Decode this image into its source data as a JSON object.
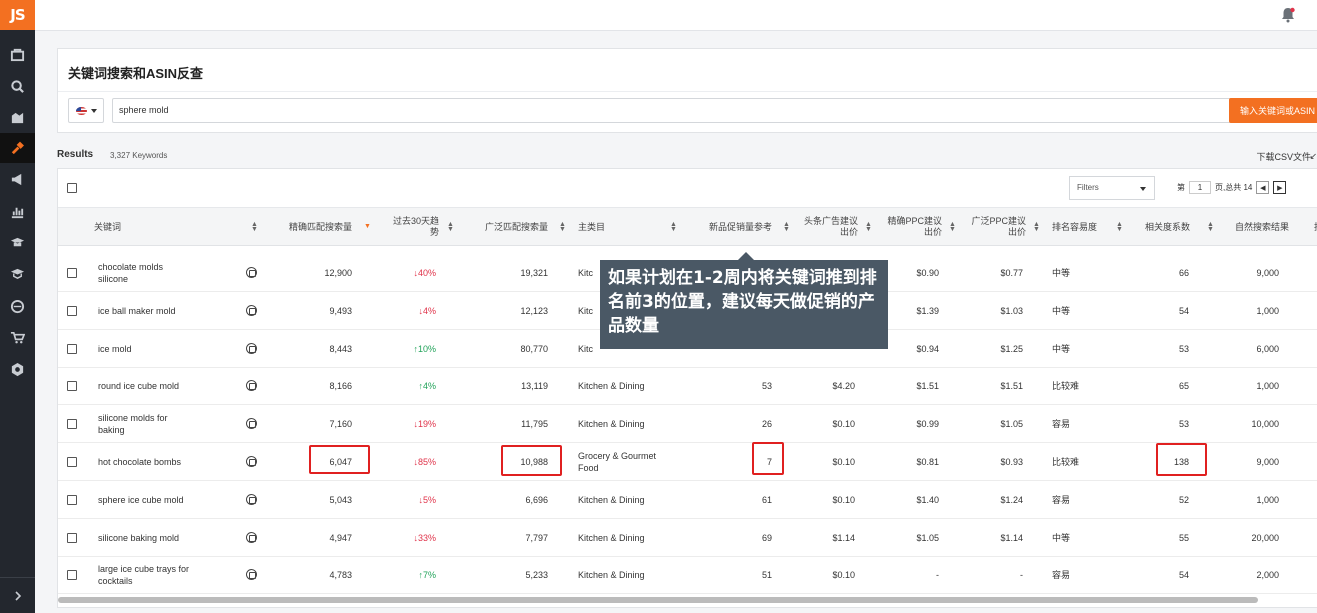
{
  "sidebar": {
    "logo": "JS",
    "icons": [
      "product-icon",
      "search-icon",
      "market-icon",
      "keyword-icon",
      "megaphone-icon",
      "chart-icon",
      "graduation-icon",
      "course-icon",
      "globe-icon",
      "cart-icon",
      "settings-icon"
    ],
    "expand_icon": "chevron-right-icon",
    "accent": "#f37021"
  },
  "topbar": {
    "notification_icon": "bell-icon"
  },
  "search": {
    "title": "关键词搜索和ASIN反查",
    "country": "US",
    "query": "sphere mold",
    "button": "输入关键词或ASIN"
  },
  "results": {
    "label": "Results",
    "count": "3,327 Keywords",
    "csv": "下载CSV文件"
  },
  "toolbar": {
    "filters": "Filters",
    "page_prefix": "第",
    "page": "1",
    "page_suffix": "页,总共 14"
  },
  "columns": [
    "关键词",
    "精确匹配搜索量",
    "过去30天趋势",
    "广泛匹配搜索量",
    "主类目",
    "新品促销量参考",
    "头条广告建议出价",
    "精确PPC建议出价",
    "广泛PPC建议出价",
    "排名容易度",
    "相关度系数",
    "自然搜索结果",
    "投"
  ],
  "rows": [
    {
      "keyword": "chocolate molds silicone",
      "exact": "12,900",
      "trend": "↓40%",
      "trend_dir": "down",
      "broad": "19,321",
      "category": "Kitc",
      "promo": "",
      "headline": "",
      "exact_ppc": "$0.90",
      "broad_ppc": "$0.77",
      "ease": "中等",
      "relevance": "66",
      "organic": "9,000"
    },
    {
      "keyword": "ice ball maker mold",
      "exact": "9,493",
      "trend": "↓4%",
      "trend_dir": "down",
      "broad": "12,123",
      "category": "Kitc",
      "promo": "",
      "headline": "",
      "exact_ppc": "$1.39",
      "broad_ppc": "$1.03",
      "ease": "中等",
      "relevance": "54",
      "organic": "1,000"
    },
    {
      "keyword": "ice mold",
      "exact": "8,443",
      "trend": "↑10%",
      "trend_dir": "up",
      "broad": "80,770",
      "category": "Kitc",
      "promo": "",
      "headline": "",
      "exact_ppc": "$0.94",
      "broad_ppc": "$1.25",
      "ease": "中等",
      "relevance": "53",
      "organic": "6,000"
    },
    {
      "keyword": "round ice cube mold",
      "exact": "8,166",
      "trend": "↑4%",
      "trend_dir": "up",
      "broad": "13,119",
      "category": "Kitchen & Dining",
      "promo": "53",
      "headline": "$4.20",
      "exact_ppc": "$1.51",
      "broad_ppc": "$1.51",
      "ease": "比较难",
      "relevance": "65",
      "organic": "1,000"
    },
    {
      "keyword": "silicone molds for baking",
      "exact": "7,160",
      "trend": "↓19%",
      "trend_dir": "down",
      "broad": "11,795",
      "category": "Kitchen & Dining",
      "promo": "26",
      "headline": "$0.10",
      "exact_ppc": "$0.99",
      "broad_ppc": "$1.05",
      "ease": "容易",
      "relevance": "53",
      "organic": "10,000"
    },
    {
      "keyword": "hot chocolate bombs",
      "exact": "6,047",
      "trend": "↓85%",
      "trend_dir": "down",
      "broad": "10,988",
      "category": "Grocery & Gourmet Food",
      "promo": "7",
      "headline": "$0.10",
      "exact_ppc": "$0.81",
      "broad_ppc": "$0.93",
      "ease": "比较难",
      "relevance": "138",
      "organic": "9,000"
    },
    {
      "keyword": "sphere ice cube mold",
      "exact": "5,043",
      "trend": "↓5%",
      "trend_dir": "down",
      "broad": "6,696",
      "category": "Kitchen & Dining",
      "promo": "61",
      "headline": "$0.10",
      "exact_ppc": "$1.40",
      "broad_ppc": "$1.24",
      "ease": "容易",
      "relevance": "52",
      "organic": "1,000"
    },
    {
      "keyword": "silicone baking mold",
      "exact": "4,947",
      "trend": "↓33%",
      "trend_dir": "down",
      "broad": "7,797",
      "category": "Kitchen & Dining",
      "promo": "69",
      "headline": "$1.14",
      "exact_ppc": "$1.05",
      "broad_ppc": "$1.14",
      "ease": "中等",
      "relevance": "55",
      "organic": "20,000"
    },
    {
      "keyword": "large ice cube trays for cocktails",
      "exact": "4,783",
      "trend": "↑7%",
      "trend_dir": "up",
      "broad": "5,233",
      "category": "Kitchen & Dining",
      "promo": "51",
      "headline": "$0.10",
      "exact_ppc": "-",
      "broad_ppc": "-",
      "ease": "容易",
      "relevance": "54",
      "organic": "2,000"
    }
  ],
  "tooltip": {
    "text": "如果计划在1-2周内将关键词推到排名前3的位置，建议每天做促销的产品数量"
  },
  "colors": {
    "down": "#e0334a",
    "up": "#22a35a",
    "highlight": "#e02020",
    "tooltip_bg": "#4a5865"
  }
}
